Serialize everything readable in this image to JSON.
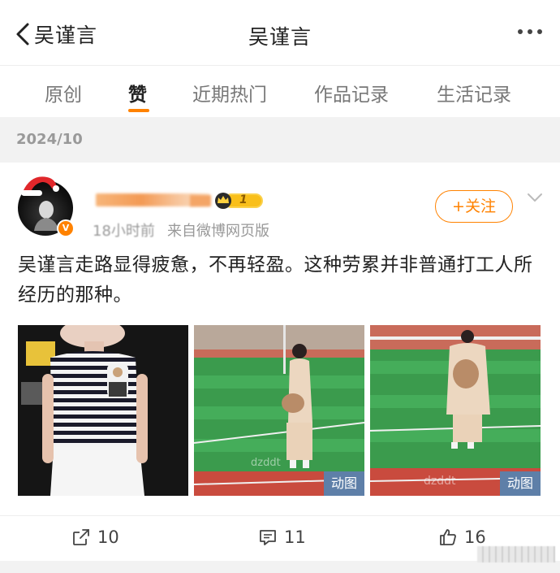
{
  "header": {
    "back_label": "吴谨言",
    "title": "吴谨言"
  },
  "tabs": [
    {
      "label": "原创",
      "active": false
    },
    {
      "label": "赞",
      "active": true
    },
    {
      "label": "近期热门",
      "active": false
    },
    {
      "label": "作品记录",
      "active": false
    },
    {
      "label": "生活记录",
      "active": false
    }
  ],
  "date_section": "2024/10",
  "post": {
    "level": "1",
    "time": "18小时前",
    "source": "来自微博网页版",
    "follow_label": "+关注",
    "text": "吴谨言走路显得疲惫，不再轻盈。这种劳累并非普通打工人所经历的那种。",
    "gif_label": "动图",
    "watermark": "dzddt",
    "actions": {
      "repost_count": "10",
      "comment_count": "11",
      "like_count": "16"
    }
  },
  "colors": {
    "accent": "#ff8200",
    "gif_badge": "#5e7fa8",
    "divider": "#f2f2f2"
  }
}
